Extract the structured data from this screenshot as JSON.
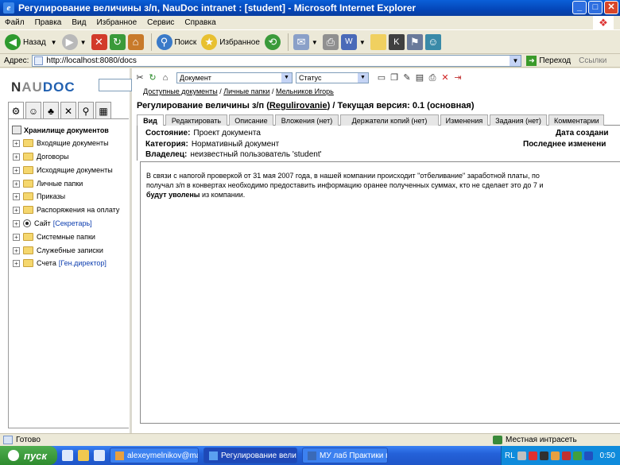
{
  "window": {
    "title": "Регулирование величины з/п,  NauDoc intranet :  [student] - Microsoft Internet Explorer",
    "app_icon": "e",
    "min": "_",
    "max": "□",
    "close": "✕"
  },
  "menu": [
    "Файл",
    "Правка",
    "Вид",
    "Избранное",
    "Сервис",
    "Справка"
  ],
  "toolbar": {
    "back_label": "Назад",
    "search_label": "Поиск",
    "favorites_label": "Избранное"
  },
  "address": {
    "label": "Адрес:",
    "url": "http://localhost:8080/docs",
    "go_label": "Переход",
    "links_label": "Ссылки"
  },
  "logo": {
    "n": "N",
    "au": "AU",
    "doc": "DOC"
  },
  "tree": {
    "root": "Хранилище документов",
    "items": [
      {
        "label": "Входящие документы",
        "role": ""
      },
      {
        "label": "Договоры",
        "role": ""
      },
      {
        "label": "Исходящие документы",
        "role": ""
      },
      {
        "label": "Личные папки",
        "role": ""
      },
      {
        "label": "Приказы",
        "role": ""
      },
      {
        "label": "Распоряжения на оплату",
        "role": ""
      },
      {
        "label": "Сайт",
        "role": "[Секретарь]"
      },
      {
        "label": "Системные папки",
        "role": ""
      },
      {
        "label": "Служебные записки",
        "role": ""
      },
      {
        "label": "Счета",
        "role": "[Ген.директор]"
      }
    ]
  },
  "doc_toolbar": {
    "type_select": "Документ",
    "status_select": "Статус"
  },
  "breadcrumb": {
    "part1": "Доступные документы",
    "sep1": " / ",
    "part2": "Личные папки",
    "sep2": " / ",
    "part3": "Мельников Игорь"
  },
  "document": {
    "title_prefix": "Регулирование величины з/п (",
    "title_id": "Regulirovanie",
    "title_suffix": ") / Текущая версия: 0.1 (основная)",
    "tabs": [
      "Вид",
      "Редактировать",
      "Описание",
      "Вложения (нет)",
      "Держатели копий (нет)",
      "Изменения",
      "Задания (нет)",
      "Комментарии"
    ],
    "state_label": "Состояние:",
    "state_value": "Проект документа",
    "category_label": "Категория:",
    "category_value": "Нормативный документ",
    "owner_label": "Владелец:",
    "owner_value": "неизвестный пользователь 'student'",
    "created_label": "Дата создани",
    "modified_label": "Последнее изменени",
    "body_line1": "В связи с напогой проверкой от 31 мая 2007 года, в нашей компании происходит \"отбеливание\" заработной платы, по",
    "body_line2": "получал з/п в конвертах необходимо предоставить информацию оранее полученных суммах, кто не сделает это до 7 и",
    "body_bold": "будут уволены",
    "body_tail": " из компании."
  },
  "status": {
    "left": "Готово",
    "zone": "Местная интрасеть"
  },
  "taskbar": {
    "start": "пуск",
    "buttons": [
      "alexeymelnikov@mail....",
      "Регулирование вели...",
      "МУ лаб Практики по..."
    ],
    "lang": "RL",
    "clock": "0:50"
  }
}
